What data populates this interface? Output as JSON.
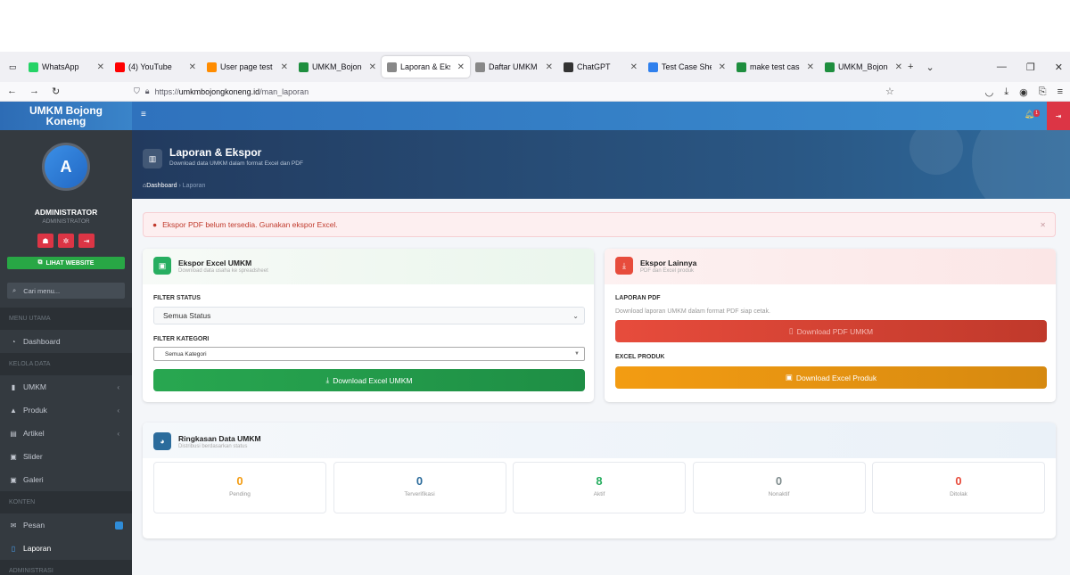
{
  "browser": {
    "tabs": [
      {
        "label": "WhatsApp",
        "color": "#25d366",
        "active": false
      },
      {
        "label": "(4) YouTube",
        "color": "#ff0000",
        "active": false
      },
      {
        "label": "User page test case",
        "color": "#ff8c00",
        "active": false
      },
      {
        "label": "UMKM_Bojong_Kor",
        "color": "#1e8e3e",
        "active": false
      },
      {
        "label": "Laporan & Ekspor -",
        "color": "#888888",
        "active": true
      },
      {
        "label": "Daftar UMKM — UI",
        "color": "#888888",
        "active": false
      },
      {
        "label": "ChatGPT",
        "color": "#333333",
        "active": false
      },
      {
        "label": "Test Case Sheet for",
        "color": "#2f80ed",
        "active": false
      },
      {
        "label": "make test case both",
        "color": "#1e8e3e",
        "active": false
      },
      {
        "label": "UMKM_Bojong_Kor",
        "color": "#1e8e3e",
        "active": false
      }
    ],
    "url_prefix": "https://",
    "url_domain": "umkmbojongkoneng.id",
    "url_path": "/man_laporan"
  },
  "sidebar": {
    "brand_line1": "UMKM Bojong",
    "brand_line2": "Koneng",
    "avatar_letter": "A",
    "user_name": "ADMINISTRATOR",
    "user_role": "ADMINISTRATOR",
    "site_button": "LIHAT WEBSITE",
    "search_placeholder": "Cari menu...",
    "header_main": "MENU UTAMA",
    "item_dashboard": "Dashboard",
    "header_data": "KELOLA DATA",
    "item_umkm": "UMKM",
    "item_produk": "Produk",
    "item_artikel": "Artikel",
    "item_slider": "Slider",
    "item_galeri": "Galeri",
    "header_konten": "KONTEN",
    "item_pesan": "Pesan",
    "item_laporan": "Laporan",
    "header_admin": "ADMINISTRASI"
  },
  "header": {
    "notif_count": "1"
  },
  "hero": {
    "title": "Laporan & Ekspor",
    "subtitle": "Download data UMKM dalam format Excel dan PDF",
    "crumb_home": "Dashboard",
    "crumb_current": "Laporan"
  },
  "alert": {
    "text": "Ekspor PDF belum tersedia. Gunakan ekspor Excel."
  },
  "excel_card": {
    "title": "Ekspor Excel UMKM",
    "subtitle": "Download data usaha ke spreadsheet",
    "filter_status_label": "FILTER STATUS",
    "filter_status_value": "Semua Status",
    "filter_kategori_label": "FILTER KATEGORI",
    "filter_kategori_value": "Semua Kategori",
    "download_button": "Download Excel UMKM"
  },
  "other_card": {
    "title": "Ekspor Lainnya",
    "subtitle": "PDF dan Excel produk",
    "pdf_label": "LAPORAN PDF",
    "pdf_desc": "Download laporan UMKM dalam format PDF siap cetak.",
    "pdf_button": "Download PDF UMKM",
    "excel_label": "EXCEL PRODUK",
    "excel_button": "Download Excel Produk"
  },
  "summary_card": {
    "title": "Ringkasan Data UMKM",
    "subtitle": "Distribusi berdasarkan status",
    "stats": [
      {
        "value": "0",
        "label": "Pending",
        "color": "#f39c12"
      },
      {
        "value": "0",
        "label": "Terverifikasi",
        "color": "#2c6c9c"
      },
      {
        "value": "8",
        "label": "Aktif",
        "color": "#27ae60"
      },
      {
        "value": "0",
        "label": "Nonaktif",
        "color": "#7f8c8d"
      },
      {
        "value": "0",
        "label": "Ditolak",
        "color": "#e74c3c"
      }
    ]
  }
}
